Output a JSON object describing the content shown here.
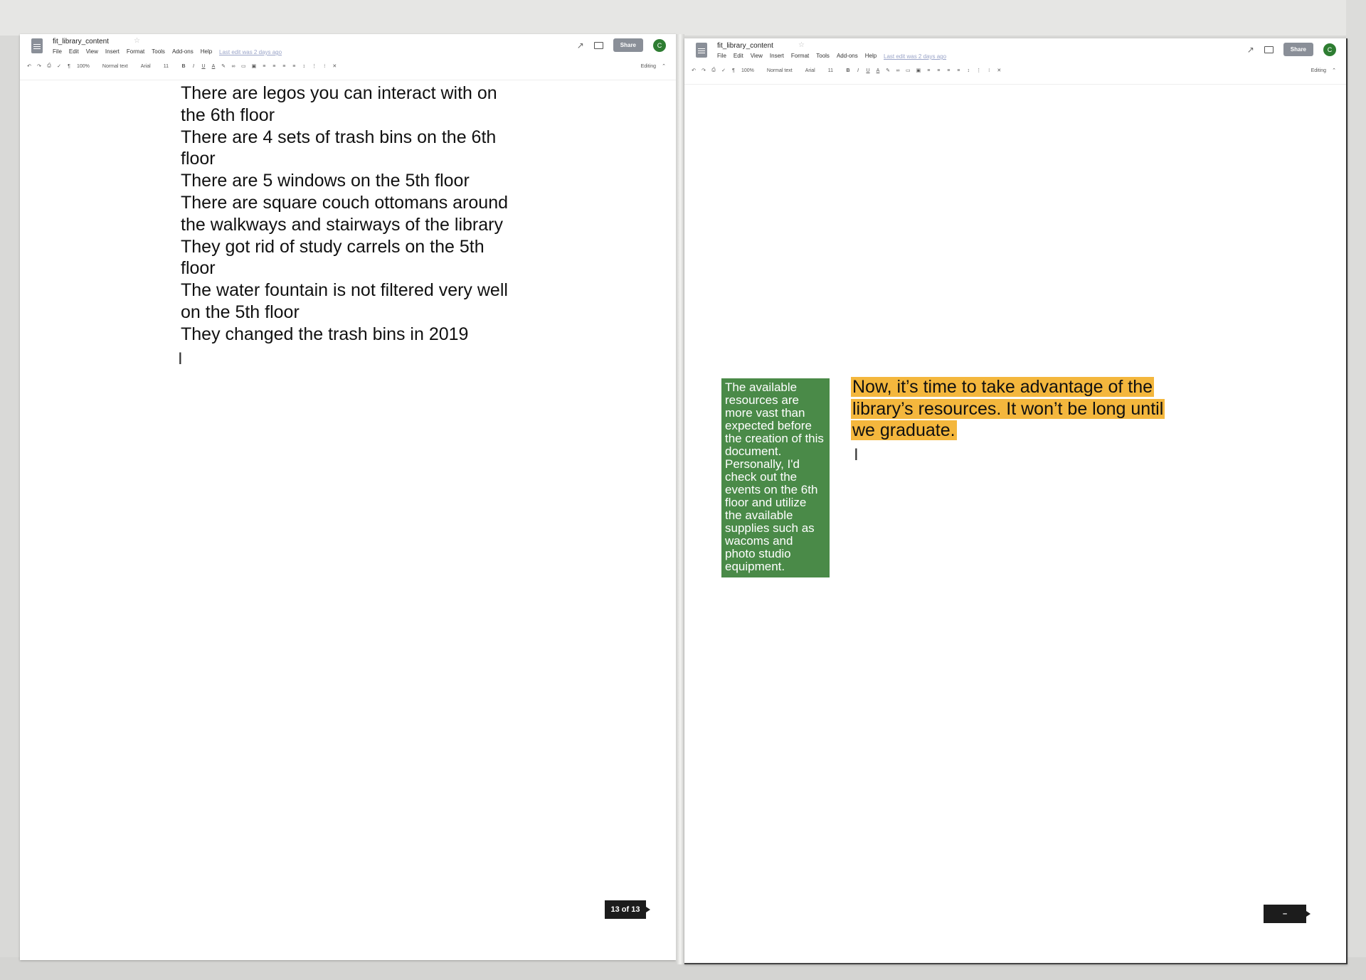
{
  "left_window": {
    "doc_title": "fit_library_content",
    "menu": [
      "File",
      "Edit",
      "View",
      "Insert",
      "Format",
      "Tools",
      "Add-ons",
      "Help"
    ],
    "last_edit": "Last edit was 2 days ago",
    "share_label": "Share",
    "avatar_initial": "C",
    "toolbar": {
      "zoom": "100%",
      "style": "Normal text",
      "font": "Arial",
      "size": "11",
      "bold": "B",
      "italic": "I",
      "underline": "U",
      "text_color": "A",
      "mode": "Editing"
    },
    "content": [
      "There are legos you can interact with on the 6th floor",
      "There are 4 sets of trash bins on the 6th floor",
      "There are 5 windows on the 5th floor",
      "There are square couch ottomans around the walkways and stairways of the library",
      "They got rid of study carrels on the 5th floor",
      "The water fountain is not filtered very well on the 5th floor",
      "They changed the trash bins in 2019"
    ],
    "page_indicator": "13 of 13"
  },
  "right_window": {
    "doc_title": "fit_library_content",
    "menu": [
      "File",
      "Edit",
      "View",
      "Insert",
      "Format",
      "Tools",
      "Add-ons",
      "Help"
    ],
    "last_edit": "Last edit was 2 days ago",
    "share_label": "Share",
    "avatar_initial": "C",
    "toolbar": {
      "zoom": "100%",
      "style": "Normal text",
      "font": "Arial",
      "size": "11",
      "bold": "B",
      "italic": "I",
      "underline": "U",
      "text_color": "A",
      "mode": "Editing"
    },
    "green_box_text": "The available resources are more vast than expected before the creation of this document. Personally, I'd check out the events on the 6th floor and utilize the available supplies such as wacoms and photo studio equipment.",
    "highlighted_text": "Now, it’s time to take advantage of the library’s resources. It won’t be long until we graduate.",
    "page_indicator": "–"
  },
  "colors": {
    "green_box": "#4a8a48",
    "highlight": "#f4b73d",
    "share_button": "#8a8f98",
    "avatar": "#2e7d32"
  },
  "icons": [
    "doc-icon",
    "star-icon",
    "trend-icon",
    "comment-icon",
    "cursor-icon"
  ]
}
